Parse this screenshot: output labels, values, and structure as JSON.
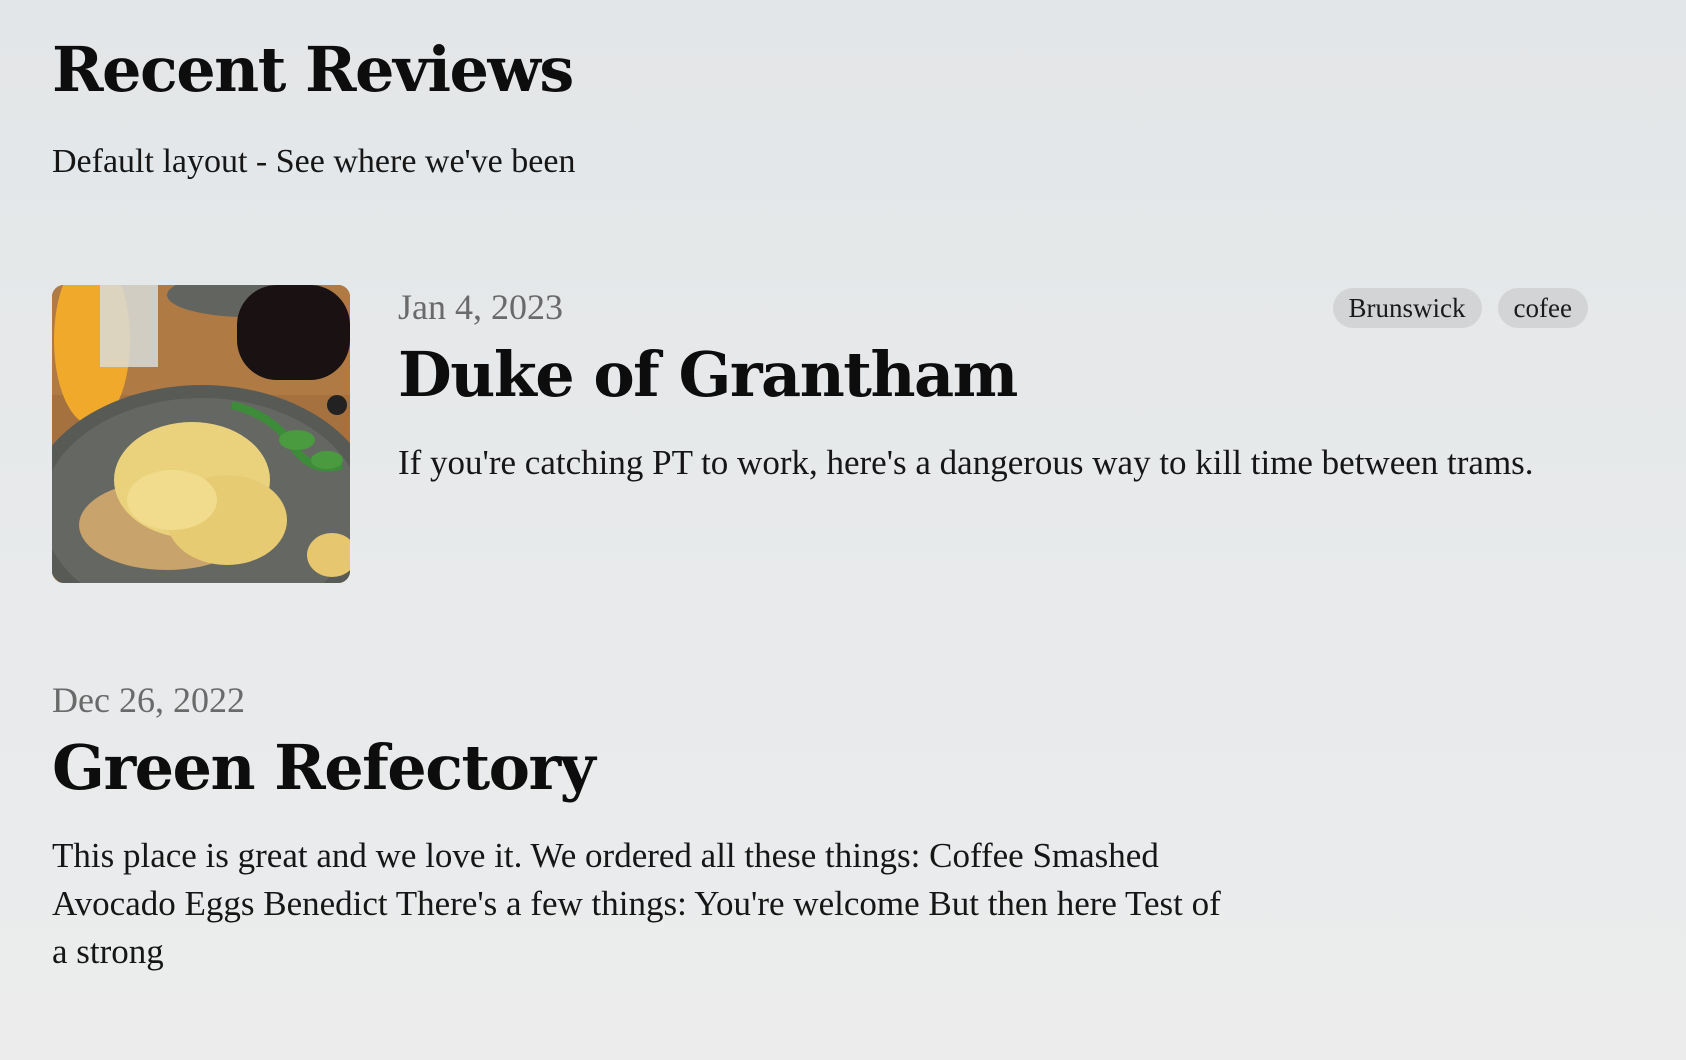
{
  "header": {
    "title": "Recent Reviews",
    "subtitle": "Default layout - See where we've been"
  },
  "reviews": [
    {
      "date": "Jan 4, 2023",
      "title": "Duke of Grantham",
      "excerpt": "If you're catching PT to work, here's a dangerous way to kill time between trams.",
      "tags": [
        "Brunswick",
        "cofee"
      ],
      "image_icon": "food-photo"
    },
    {
      "date": "Dec 26, 2022",
      "title": "Green Refectory",
      "excerpt": "This place is great and we love it. We ordered all these things: Coffee Smashed Avocado Eggs Benedict There's a few things: You're welcome But then here Test of a strong"
    }
  ]
}
